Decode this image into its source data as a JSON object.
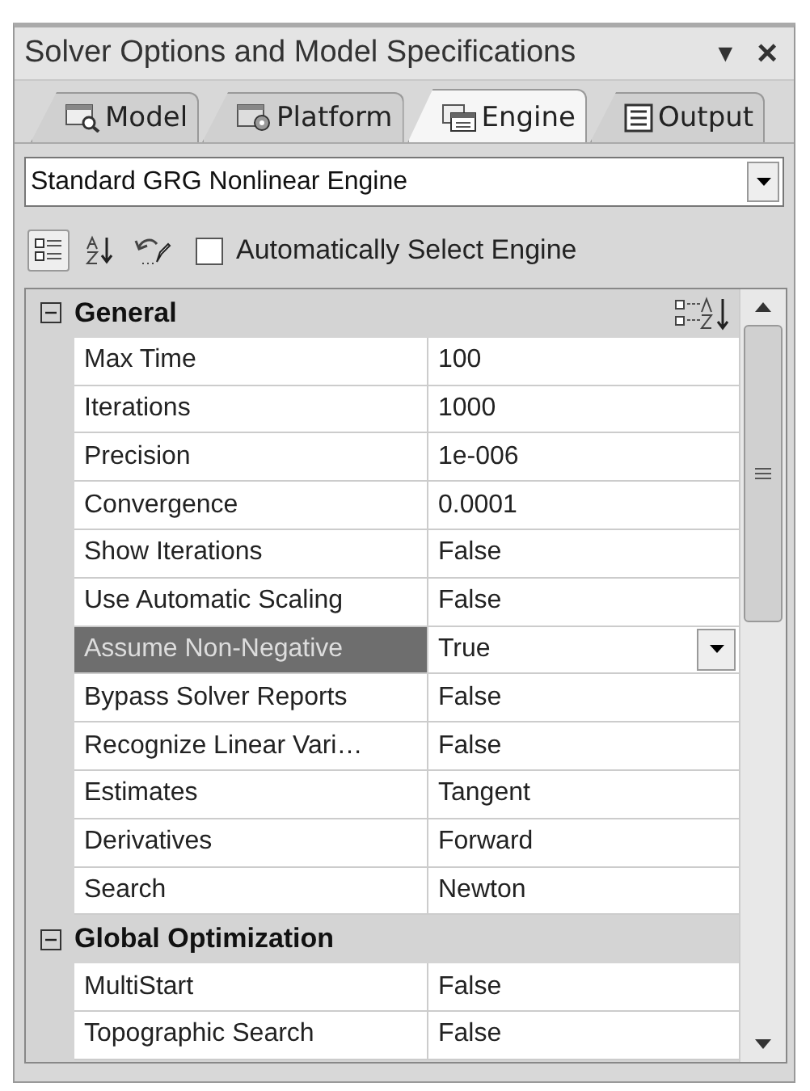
{
  "window": {
    "title": "Solver Options and Model Specifications",
    "menu_glyph": "▼",
    "close_glyph": "×"
  },
  "tabs": [
    {
      "label": "Model",
      "selected": false
    },
    {
      "label": "Platform",
      "selected": false
    },
    {
      "label": "Engine",
      "selected": true
    },
    {
      "label": "Output",
      "selected": false
    }
  ],
  "engine_select": {
    "value": "Standard GRG Nonlinear Engine"
  },
  "toolbar": {
    "categorized_selected": true,
    "alphabetical_selected": false,
    "auto_select": {
      "label": "Automatically Select Engine",
      "checked": false
    }
  },
  "grid": {
    "sections": [
      {
        "title": "General",
        "expanded": true,
        "properties": [
          {
            "name": "Max Time",
            "value": "100",
            "selected": false
          },
          {
            "name": "Iterations",
            "value": "1000",
            "selected": false
          },
          {
            "name": "Precision",
            "value": "1e-006",
            "selected": false
          },
          {
            "name": "Convergence",
            "value": "0.0001",
            "selected": false
          },
          {
            "name": "Show Iterations",
            "value": "False",
            "selected": false
          },
          {
            "name": "Use Automatic Scaling",
            "value": "False",
            "selected": false
          },
          {
            "name": "Assume Non-Negative",
            "value": "True",
            "selected": true
          },
          {
            "name": "Bypass Solver Reports",
            "value": "False",
            "selected": false
          },
          {
            "name": "Recognize Linear Vari…",
            "value": "False",
            "selected": false
          },
          {
            "name": "Estimates",
            "value": "Tangent",
            "selected": false
          },
          {
            "name": "Derivatives",
            "value": "Forward",
            "selected": false
          },
          {
            "name": "Search",
            "value": "Newton",
            "selected": false
          }
        ]
      },
      {
        "title": "Global Optimization",
        "expanded": true,
        "properties": [
          {
            "name": "MultiStart",
            "value": "False",
            "selected": false
          },
          {
            "name": "Topographic Search",
            "value": "False",
            "selected": false
          }
        ]
      }
    ]
  }
}
